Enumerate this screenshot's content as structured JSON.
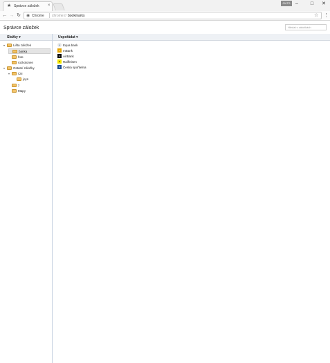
{
  "window": {
    "tab_title": "Správce záložek",
    "tab_close": "×",
    "user_badge": "GUTS",
    "minimize": "–",
    "maximize": "□",
    "close": "✕"
  },
  "toolbar": {
    "back": "←",
    "forward": "→",
    "reload": "↻",
    "security_chip": "Chrome",
    "url_scheme": "chrome://",
    "url_path": "bookmarks",
    "star": "☆",
    "menu": "⋮"
  },
  "app": {
    "title": "Správce záložek",
    "search_placeholder": "Hledat v záložkách"
  },
  "columns": {
    "left": "Složky ▾",
    "right": "Uspořádat ▾"
  },
  "tree": [
    {
      "label": "Lišta záložek",
      "expanded": true
    },
    {
      "label": "banka",
      "selected": true
    },
    {
      "label": "foto"
    },
    {
      "label": "rozkolonen"
    },
    {
      "label": "Ostatní záložky",
      "expanded": true
    },
    {
      "label": "CN",
      "expanded": true
    },
    {
      "label": "joyn"
    },
    {
      "label": "z"
    },
    {
      "label": "Mapy"
    }
  ],
  "bookmarks": [
    {
      "label": "Equa bank",
      "icon": "equa-bank-icon",
      "color": "#e8e8e8"
    },
    {
      "label": "mBank",
      "icon": "mbank-icon",
      "color": "#e4a400"
    },
    {
      "label": "AirBank",
      "icon": "airbank-icon",
      "color": "#111111"
    },
    {
      "label": "Raiffeisen",
      "icon": "raiffeisen-icon",
      "color": "#f5e600"
    },
    {
      "label": "Česká spořitelna",
      "icon": "ceska-sporitelna-icon",
      "color": "#1d4f91"
    }
  ]
}
